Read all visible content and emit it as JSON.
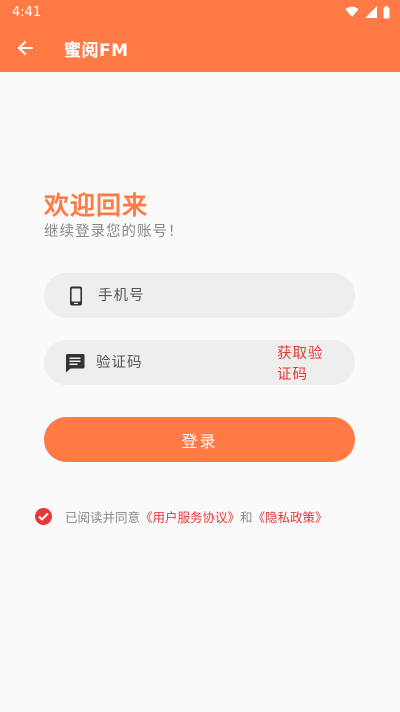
{
  "status_bar": {
    "time": "4:41"
  },
  "app_bar": {
    "title": "蜜阅FM"
  },
  "welcome": {
    "title": "欢迎回来",
    "subtitle": "继续登录您的账号！"
  },
  "phone_field": {
    "placeholder": "手机号"
  },
  "code_field": {
    "placeholder": "验证码",
    "get_code_label": "获取验证码"
  },
  "login_button": {
    "label": "登录"
  },
  "agreement": {
    "prefix": "已阅读并同意",
    "user_agreement": "《用户服务协议》",
    "conjunction": "和",
    "privacy_policy": "《隐私政策》",
    "checked": true
  },
  "colors": {
    "accent": "#FF7A45",
    "link": "#E53935",
    "field_bg": "#EEEEEE"
  }
}
